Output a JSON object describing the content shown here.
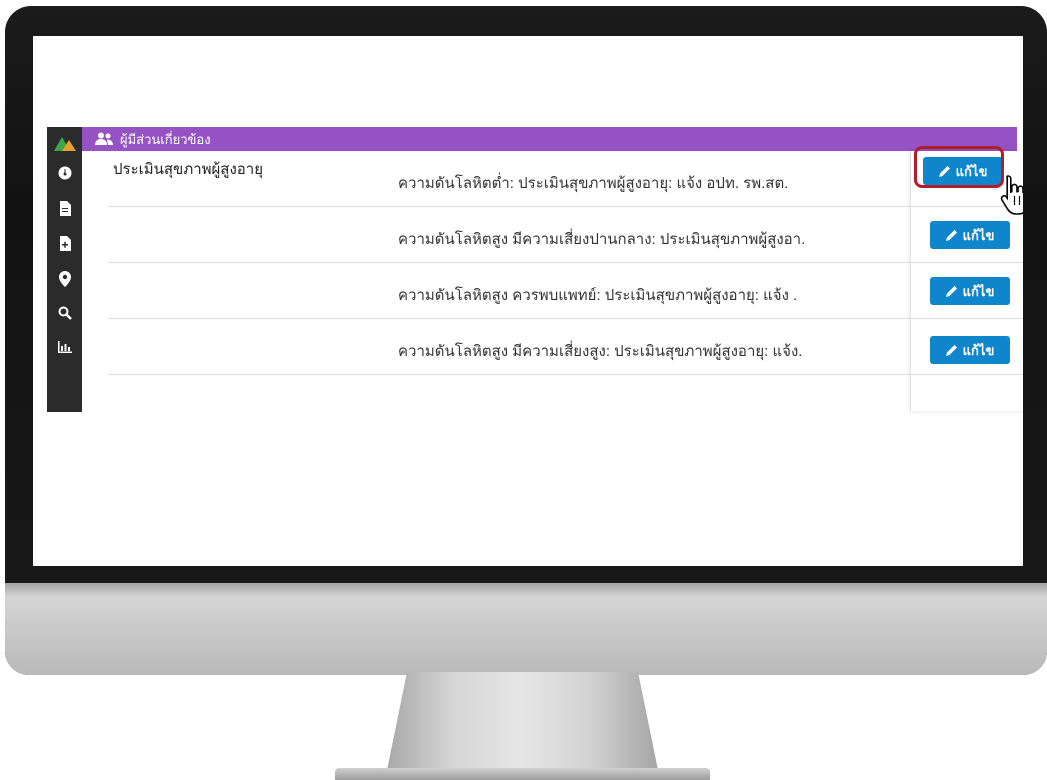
{
  "panel": {
    "title": "ผู้มีส่วนเกี่ยวข้อง"
  },
  "rows": [
    {
      "group": "ประเมินสุขภาพผู้สูงอายุ",
      "item": "ความดันโลหิตต่ำ: ประเมินสุขภาพผู้สูงอายุ: แจ้ง อปท. รพ.สต.",
      "button": "แก้ไข"
    },
    {
      "group": "",
      "item": "ความดันโลหิตสูง มีความเสี่ยงปานกลาง: ประเมินสุขภาพผู้สูงอา.",
      "button": "แก้ไข"
    },
    {
      "group": "",
      "item": "ความดันโลหิตสูง ควรพบแพทย์: ประเมินสุขภาพผู้สูงอายุ: แจ้ง .",
      "button": "แก้ไข"
    },
    {
      "group": "",
      "item": "ความดันโลหิตสูง มีความเสี่ยงสูง: ประเมินสุขภาพผู้สูงอายุ: แจ้ง.",
      "button": "แก้ไข"
    }
  ],
  "sidebar": {
    "icons": [
      "logo-icon",
      "dashboard-icon",
      "document-icon",
      "document-add-icon",
      "map-marker-icon",
      "search-icon",
      "bar-chart-icon"
    ]
  },
  "colors": {
    "header": "#9552c4",
    "button": "#0f85cc",
    "highlight": "#b01e2e",
    "sidebar": "#2b2b2b"
  }
}
